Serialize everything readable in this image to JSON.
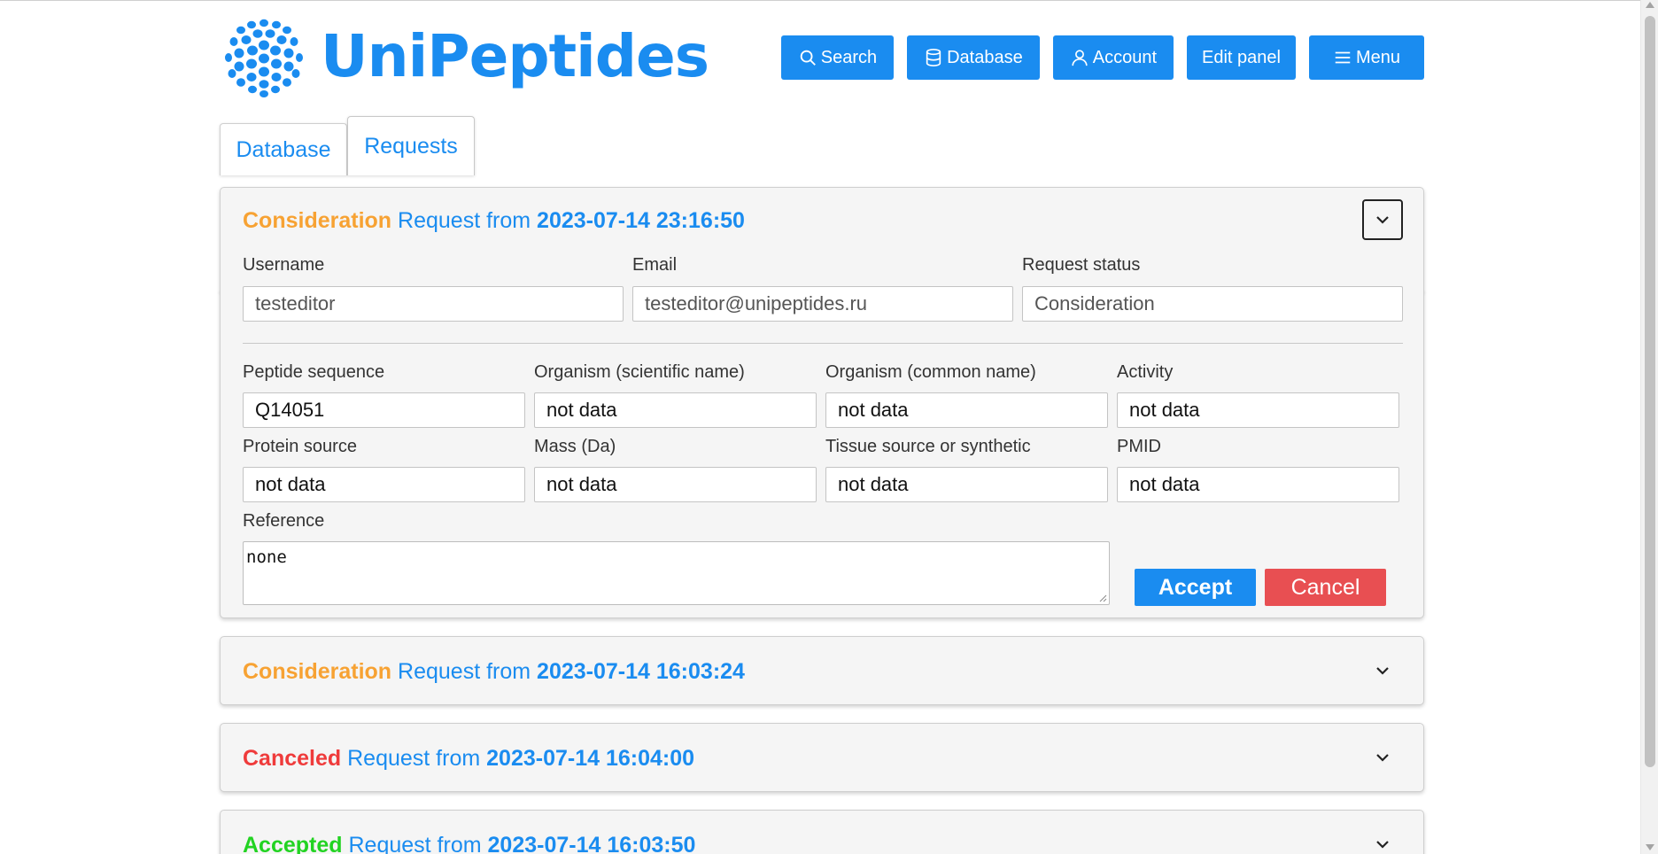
{
  "app": {
    "title": "UniPeptides"
  },
  "nav": {
    "search": "Search",
    "database": "Database",
    "account": "Account",
    "edit_panel": "Edit panel",
    "menu": "Menu"
  },
  "tabs": {
    "database": "Database",
    "requests": "Requests"
  },
  "requests": [
    {
      "status": "Consideration",
      "request_from": "Request from",
      "date": "2023-07-14 23:16:50",
      "expanded": true,
      "username_label": "Username",
      "username": "testeditor",
      "email_label": "Email",
      "email": "testeditor@unipeptides.ru",
      "request_status_label": "Request status",
      "request_status": "Consideration",
      "peptide_sequence_label": "Peptide sequence",
      "peptide_sequence": "Q14051",
      "organism_scientific_label": "Organism (scientific name)",
      "organism_scientific": "not data",
      "organism_common_label": "Organism (common name)",
      "organism_common": "not data",
      "activity_label": "Activity",
      "activity": "not data",
      "protein_source_label": "Protein source",
      "protein_source": "not data",
      "mass_label": "Mass (Da)",
      "mass": "not data",
      "tissue_source_label": "Tissue source or synthetic",
      "tissue_source": "not data",
      "pmid_label": "PMID",
      "pmid": "not data",
      "reference_label": "Reference",
      "reference": "none",
      "accept_label": "Accept",
      "cancel_label": "Cancel"
    },
    {
      "status": "Consideration",
      "request_from": "Request from",
      "date": "2023-07-14 16:03:24",
      "expanded": false
    },
    {
      "status": "Canceled",
      "request_from": "Request from",
      "date": "2023-07-14 16:04:00",
      "expanded": false
    },
    {
      "status": "Accepted",
      "request_from": "Request from",
      "date": "2023-07-14 16:03:50",
      "expanded": false
    }
  ],
  "colors": {
    "brand": "#1a8cf0",
    "consideration": "#f7a233",
    "canceled": "#ef3b3b",
    "accepted": "#22d322",
    "cancel_button": "#e84f52"
  }
}
